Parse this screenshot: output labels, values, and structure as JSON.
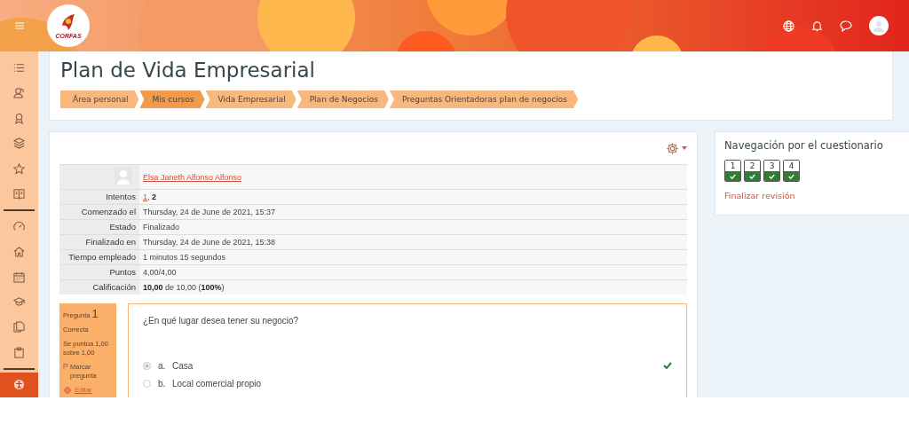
{
  "header": {
    "logo_text": "CORFAS"
  },
  "sidebar": {
    "groups": [
      [
        {
          "selected": false
        },
        {
          "selected": false
        },
        {
          "selected": false
        },
        {
          "selected": false
        },
        {
          "selected": false
        },
        {
          "selected": false
        }
      ],
      [
        {
          "selected": false
        },
        {
          "selected": false
        },
        {
          "selected": false
        },
        {
          "selected": false
        },
        {
          "selected": false
        },
        {
          "selected": false
        }
      ],
      [
        {
          "selected": true
        }
      ]
    ]
  },
  "page_title": "Plan de Vida Empresarial",
  "breadcrumbs": [
    {
      "label": "Área personal",
      "selected": false
    },
    {
      "label": "Mis cursos",
      "selected": true
    },
    {
      "label": "Vida Empresarial",
      "selected": false
    },
    {
      "label": "Plan de Negocios",
      "selected": false
    },
    {
      "label": "Preguntas Orientadoras plan de negocios",
      "selected": false
    }
  ],
  "summary": {
    "user": "Elsa Janeth Alfonso Alfonso",
    "rows": [
      {
        "kind": "attempts",
        "label": "Intentos",
        "separator": ",",
        "attempts": [
          {
            "label": "1",
            "current": false
          },
          {
            "label": "2",
            "current": true
          }
        ]
      },
      {
        "kind": "text",
        "label": "Comenzado el",
        "value": "Thursday, 24 de June de 2021, 15:37"
      },
      {
        "kind": "text",
        "label": "Estado",
        "value": "Finalizado"
      },
      {
        "kind": "text",
        "label": "Finalizado en",
        "value": "Thursday, 24 de June de 2021, 15:38"
      },
      {
        "kind": "text",
        "label": "Tiempo empleado",
        "value": "1 minutos 15 segundos"
      },
      {
        "kind": "text",
        "label": "Puntos",
        "value": "4,00/4,00"
      },
      {
        "kind": "text",
        "label": "Calificación",
        "value": "**10,00** de 10,00 (**100%**)"
      }
    ]
  },
  "question": {
    "label": "Pregunta",
    "number": "1",
    "status": "Correcta",
    "score": "Se puntúa 1,00 sobre 1,00",
    "flag": "Marcar pregunta",
    "edit": "Editar",
    "text": "¿En qué lugar desea tener su negocio?",
    "answers": [
      {
        "letter": "a.",
        "label": "Casa",
        "selected": true,
        "correct": true
      },
      {
        "letter": "b.",
        "label": "Local comercial propio",
        "selected": false,
        "correct": false
      }
    ]
  },
  "quiz_navigation": {
    "title": "Navegación por el cuestionario",
    "questions": [
      {
        "label": "1",
        "answered": true
      },
      {
        "label": "2",
        "answered": true
      },
      {
        "label": "3",
        "answered": true
      },
      {
        "label": "4",
        "answered": true
      }
    ],
    "finish": "Finalizar revisión"
  }
}
